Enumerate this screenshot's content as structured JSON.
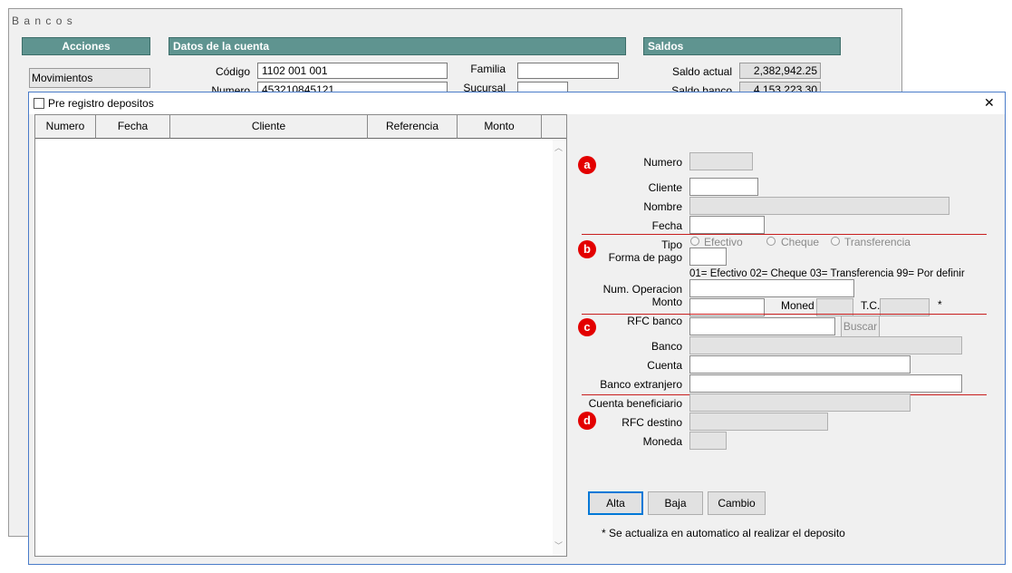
{
  "bg_window": {
    "title": "B a n c o s",
    "acciones_label": "Acciones",
    "movimientos_label": "Movimientos",
    "datos_cuenta_label": "Datos de la cuenta",
    "saldos_label": "Saldos",
    "codigo_label": "Código",
    "codigo_value": "1102 001 001",
    "numero_label": "Numero",
    "numero_value": "453210845121",
    "familia_label": "Familia",
    "sucursal_label": "Sucursal",
    "saldo_actual_label": "Saldo actual",
    "saldo_actual_value": "2,382,942.25",
    "saldo_banco_label": "Saldo banco",
    "saldo_banco_value": "4,153,223.30"
  },
  "dialog": {
    "title": "Pre registro depositos",
    "close_glyph": "✕",
    "table": {
      "columns": [
        "Numero",
        "Fecha",
        "Cliente",
        "Referencia",
        "Monto"
      ],
      "rows": []
    },
    "badges": [
      "a",
      "b",
      "c",
      "d"
    ],
    "form": {
      "numero_label": "Numero",
      "cliente_label": "Cliente",
      "nombre_label": "Nombre",
      "fecha_label": "Fecha",
      "tipo_label": "Tipo",
      "tipo_options": [
        "Efectivo",
        "Cheque",
        "Transferencia"
      ],
      "forma_pago_label": "Forma de pago",
      "forma_pago_hint": "01= Efectivo  02= Cheque  03= Transferencia  99= Por definir",
      "num_operacion_label": "Num. Operacion",
      "monto_label": "Monto",
      "moneda_label": "Moned",
      "tc_label": "T.C.",
      "asterisk": "*",
      "rfc_banco_label": "RFC banco",
      "buscar_label": "Buscar",
      "banco_label": "Banco",
      "cuenta_label": "Cuenta",
      "banco_extranjero_label": "Banco extranjero",
      "cuenta_beneficiario_label": "Cuenta beneficiario",
      "rfc_destino_label": "RFC destino",
      "moneda2_label": "Moneda"
    },
    "buttons": {
      "alta": "Alta",
      "baja": "Baja",
      "cambio": "Cambio"
    },
    "footnote": "* Se actualiza en automatico al realizar el deposito"
  },
  "colors": {
    "teal_header": "#5f9490",
    "red_marker": "#e30000",
    "dialog_border": "#4a7cc9"
  }
}
